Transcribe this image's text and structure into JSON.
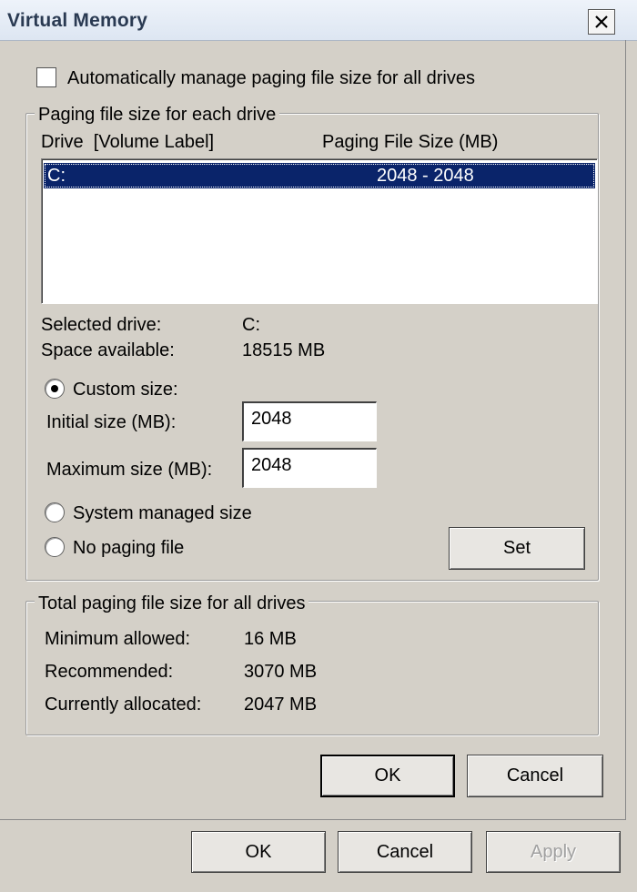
{
  "window": {
    "title": "Virtual Memory"
  },
  "auto_manage": {
    "label": "Automatically manage paging file size for all drives",
    "checked": false
  },
  "drives_group": {
    "legend": "Paging file size for each drive",
    "col_drive": "Drive  [Volume Label]",
    "col_size": "Paging File Size (MB)",
    "rows": [
      {
        "drive": "C:",
        "size": "2048 - 2048",
        "selected": true
      }
    ]
  },
  "selected_info": {
    "selected_drive_label": "Selected drive:",
    "selected_drive_value": "C:",
    "space_label": "Space available:",
    "space_value": "18515 MB"
  },
  "custom_size": {
    "radio_label": "Custom size:",
    "initial_label": "Initial size (MB):",
    "initial_value": "2048",
    "maximum_label": "Maximum size (MB):",
    "maximum_value": "2048"
  },
  "system_managed": {
    "label": "System managed size"
  },
  "no_paging": {
    "label": "No paging file"
  },
  "set_button": {
    "label": "Set"
  },
  "totals_group": {
    "legend": "Total paging file size for all drives",
    "min_label": "Minimum allowed:",
    "min_value": "16 MB",
    "rec_label": "Recommended:",
    "rec_value": "3070 MB",
    "cur_label": "Currently allocated:",
    "cur_value": "2047 MB"
  },
  "dialog_buttons": {
    "ok": "OK",
    "cancel": "Cancel"
  },
  "parent_buttons": {
    "ok": "OK",
    "cancel": "Cancel",
    "apply": "Apply"
  },
  "colors": {
    "selection": "#0a246a",
    "face": "#d4d0c8",
    "title_text": "#2a3a52"
  }
}
